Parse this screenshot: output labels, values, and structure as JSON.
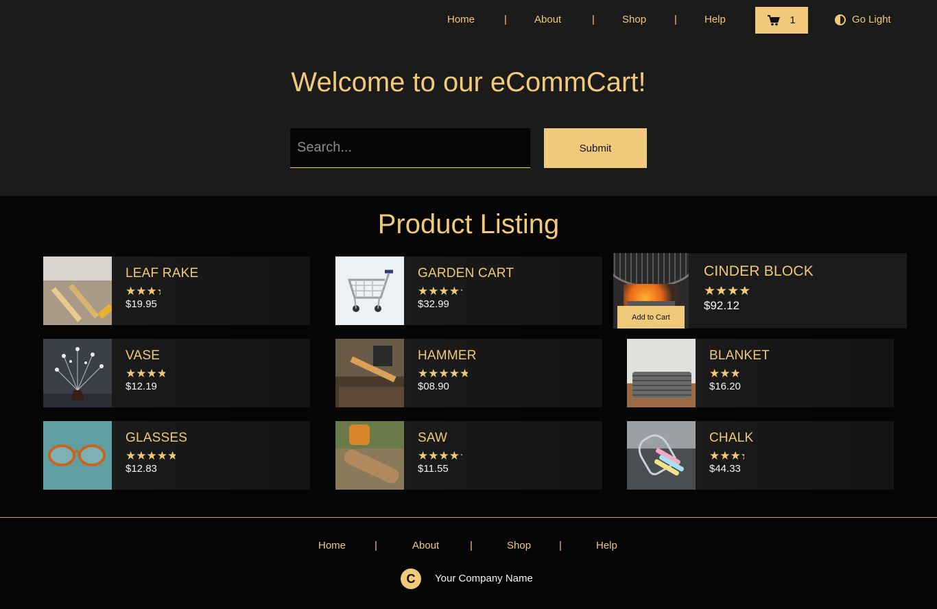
{
  "nav": {
    "links": [
      "Home",
      "About",
      "Shop",
      "Help"
    ],
    "separator": "|",
    "cart_count": "1",
    "theme_label": "Go Light"
  },
  "hero": {
    "title": "Welcome to our eCommCart!",
    "search_placeholder": "Search...",
    "submit_label": "Submit"
  },
  "listing": {
    "title": "Product Listing",
    "add_to_cart_label": "Add to Cart",
    "products": [
      {
        "name": "LEAF RAKE",
        "rating": 3.5,
        "price": "$19.95",
        "image": "rake-on-floor"
      },
      {
        "name": "GARDEN CART",
        "rating": 4.5,
        "price": "$32.99",
        "image": "shopping-cart"
      },
      {
        "name": "CINDER BLOCK",
        "rating": 4.5,
        "price": "$92.12",
        "image": "grill-fire"
      },
      {
        "name": "VASE",
        "rating": 4,
        "price": "$12.19",
        "image": "vase-flowers"
      },
      {
        "name": "HAMMER",
        "rating": 5,
        "price": "$08.90",
        "image": "hammer-anvil"
      },
      {
        "name": "BLANKET",
        "rating": 3,
        "price": "$16.20",
        "image": "folded-blanket"
      },
      {
        "name": "GLASSES",
        "rating": 5,
        "price": "$12.83",
        "image": "eyeglasses"
      },
      {
        "name": "SAW",
        "rating": 4.5,
        "price": "$11.55",
        "image": "chainsaw-log"
      },
      {
        "name": "CHALK",
        "rating": 3.5,
        "price": "$44.33",
        "image": "chalk-cup"
      }
    ]
  },
  "footer": {
    "links": [
      "Home",
      "About",
      "Shop",
      "Help"
    ],
    "separator": "|",
    "logo_letter": "C",
    "company": "Your Company Name"
  },
  "colors": {
    "accent": "#f0c97b",
    "header_bg": "#1b1b1b",
    "page_bg": "#050505"
  }
}
